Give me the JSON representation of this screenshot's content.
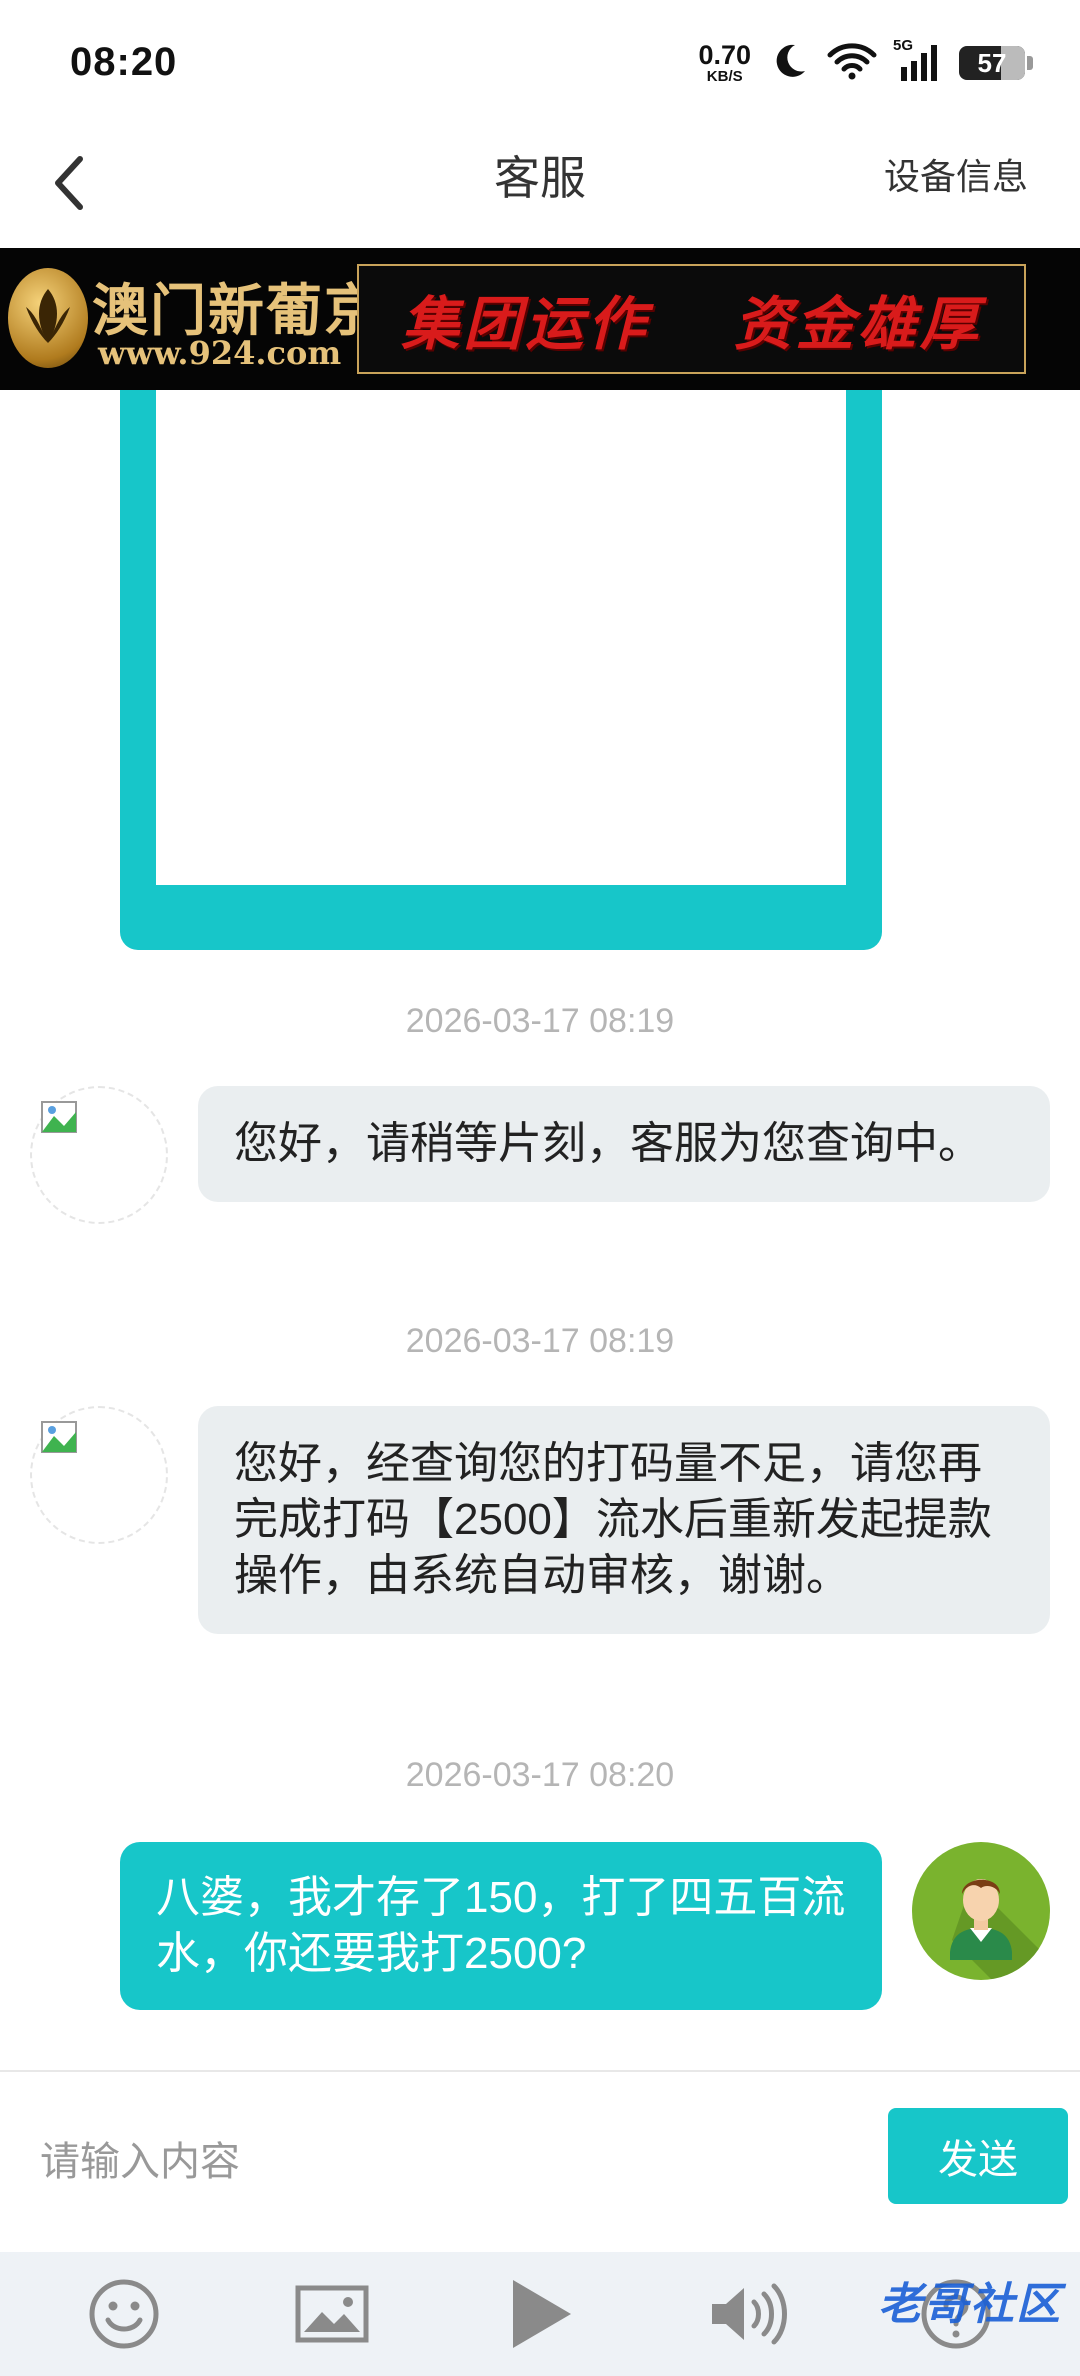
{
  "status_bar": {
    "time": "08:20",
    "net_speed_value": "0.70",
    "net_speed_unit": "KB/S",
    "network": "5G",
    "battery": "57"
  },
  "header": {
    "back_icon": "chevron-left-icon",
    "title": "客服",
    "device_info": "设备信息"
  },
  "banner": {
    "brand": "澳门新葡京",
    "url": "www.924.com",
    "slogan_1": "集团运作",
    "slogan_2": "资金雄厚"
  },
  "messages": [
    {
      "type": "image",
      "sender": "me"
    },
    {
      "timestamp": "2026-03-17 08:19",
      "sender": "service",
      "text": "您好，请稍等片刻，客服为您查询中。"
    },
    {
      "timestamp": "2026-03-17 08:19",
      "sender": "service",
      "text": "您好，经查询您的打码量不足，请您再完成打码【2500】流水后重新发起提款操作，由系统自动审核，谢谢。"
    },
    {
      "timestamp": "2026-03-17 08:20",
      "sender": "me",
      "text": "八婆，我才存了150，打了四五百流水，你还要我打2500?"
    }
  ],
  "input": {
    "placeholder": "请输入内容",
    "value": "",
    "send_label": "发送"
  },
  "toolbar": {
    "items": [
      "emoji-icon",
      "image-icon",
      "play-icon",
      "speaker-icon",
      "help-icon"
    ]
  },
  "watermark": "老哥社区",
  "colors": {
    "accent": "#17c6c9",
    "service_bubble": "#eaeef0",
    "timestamp": "#b5b5b5",
    "toolbar_bg": "#eef2f6"
  }
}
